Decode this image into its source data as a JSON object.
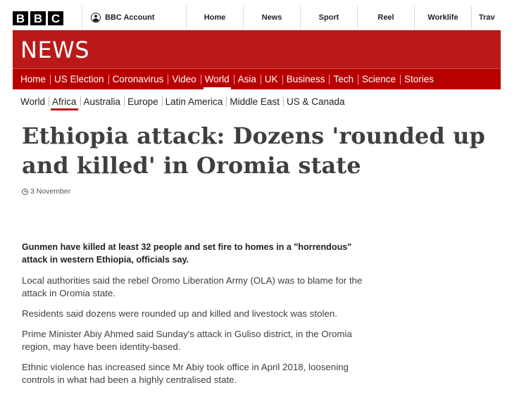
{
  "masthead": {
    "logo_letters": [
      "B",
      "B",
      "C"
    ],
    "account_label": "BBC Account",
    "nav": [
      "Home",
      "News",
      "Sport",
      "Reel",
      "Worklife",
      "Trav"
    ]
  },
  "brand": {
    "title": "NEWS",
    "color": "#bb1919"
  },
  "sections": [
    "Home",
    "US Election",
    "Coronavirus",
    "Video",
    "World",
    "Asia",
    "UK",
    "Business",
    "Tech",
    "Science",
    "Stories"
  ],
  "active_section": "World",
  "subsections": [
    "World",
    "Africa",
    "Australia",
    "Europe",
    "Latin America",
    "Middle East",
    "US & Canada"
  ],
  "active_subsection": "Africa",
  "article": {
    "headline": "Ethiopia attack: Dozens 'rounded up and killed' in Oromia state",
    "date": "3 November",
    "paragraphs": [
      "Gunmen have killed at least 32 people and set fire to homes in a \"horrendous\" attack in western Ethiopia, officials say.",
      "Local authorities said the rebel Oromo Liberation Army (OLA) was to blame for the attack in Oromia state.",
      "Residents said dozens were rounded up and killed and livestock was stolen.",
      "Prime Minister Abiy Ahmed said Sunday's attack in Guliso district, in the Oromia region, may have been identity-based.",
      "Ethnic violence has increased since Mr Abiy took office in April 2018, loosening controls in what had been a highly centralised state."
    ]
  }
}
